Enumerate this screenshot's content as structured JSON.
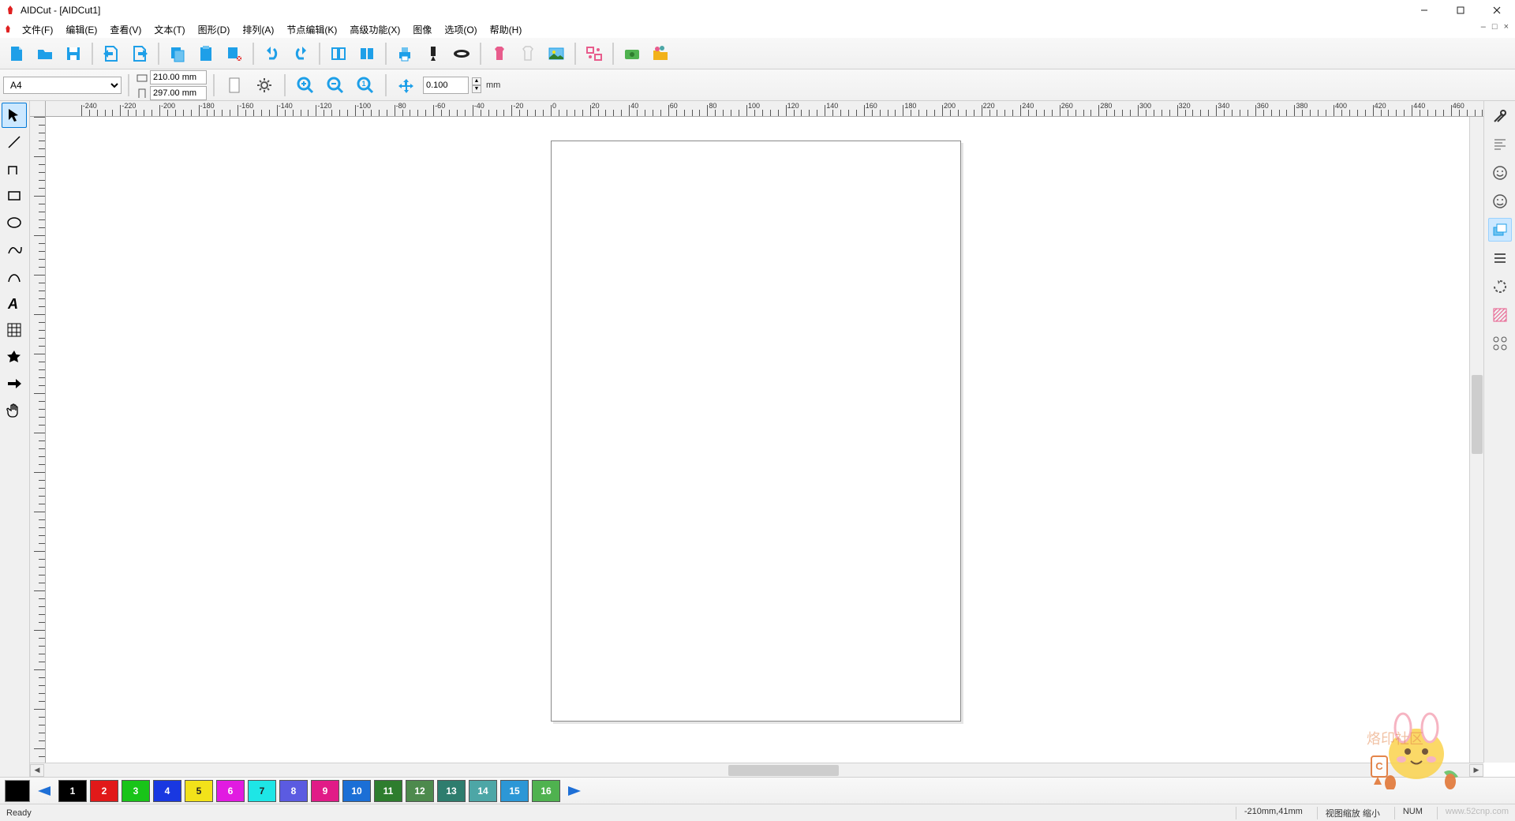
{
  "window": {
    "title": "AIDCut - [AIDCut1]"
  },
  "menu": {
    "file": "文件(F)",
    "edit": "编辑(E)",
    "view": "查看(V)",
    "text": "文本(T)",
    "shape": "图形(D)",
    "arrange": "排列(A)",
    "node": "节点编辑(K)",
    "advanced": "高级功能(X)",
    "image": "图像",
    "options": "选项(O)",
    "help": "帮助(H)"
  },
  "propbar": {
    "pagesize": "A4",
    "width": "210.00 mm",
    "height": "297.00 mm",
    "offset": "0.100",
    "unit": "mm"
  },
  "ruler_values": [
    -240,
    -220,
    -200,
    -180,
    -160,
    -140,
    -120,
    -100,
    -80,
    -60,
    -40,
    -20,
    0,
    20,
    40,
    60,
    80,
    100,
    120,
    140,
    160,
    180,
    200,
    220,
    240,
    260,
    280,
    300,
    320,
    340,
    360,
    380,
    400,
    420,
    440,
    460
  ],
  "colorbar": {
    "swatches": [
      {
        "n": "1",
        "c": "#000000"
      },
      {
        "n": "2",
        "c": "#E11919"
      },
      {
        "n": "3",
        "c": "#19C419"
      },
      {
        "n": "4",
        "c": "#1938E1"
      },
      {
        "n": "5",
        "c": "#F2E21A"
      },
      {
        "n": "6",
        "c": "#E11BE1"
      },
      {
        "n": "7",
        "c": "#1EE6E6"
      },
      {
        "n": "8",
        "c": "#5B5BE1"
      },
      {
        "n": "9",
        "c": "#E11B87"
      },
      {
        "n": "10",
        "c": "#1B6FD6"
      },
      {
        "n": "11",
        "c": "#2E7D2E"
      },
      {
        "n": "12",
        "c": "#4D8A4D"
      },
      {
        "n": "13",
        "c": "#2E7D6E"
      },
      {
        "n": "14",
        "c": "#4DA6A6"
      },
      {
        "n": "15",
        "c": "#2C97D6"
      },
      {
        "n": "16",
        "c": "#4FB24F"
      }
    ]
  },
  "status": {
    "ready": "Ready",
    "coords": "-210mm,41mm",
    "action": "视图缩放 缩小",
    "num": "NUM"
  },
  "watermark": "www.52cnp.com"
}
